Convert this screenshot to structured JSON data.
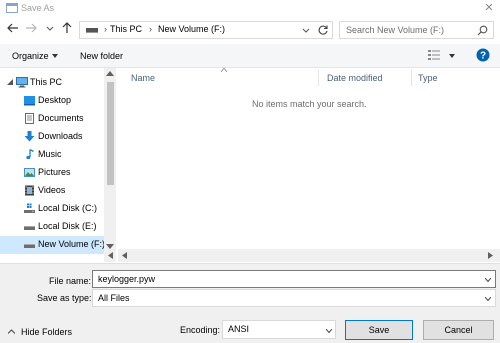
{
  "window": {
    "title": "Save As",
    "close_glyph": "✕"
  },
  "address": {
    "separator": "›",
    "crumbs": [
      "This PC",
      "New Volume (F:)"
    ]
  },
  "search": {
    "placeholder": "Search New Volume (F:)"
  },
  "toolbar": {
    "organize_label": "Organize",
    "new_folder_label": "New folder",
    "help_glyph": "?"
  },
  "sidebar": {
    "items": [
      {
        "label": "This PC",
        "icon": "monitor-icon"
      },
      {
        "label": "Desktop",
        "icon": "desktop-icon"
      },
      {
        "label": "Documents",
        "icon": "documents-icon"
      },
      {
        "label": "Downloads",
        "icon": "download-arrow-icon"
      },
      {
        "label": "Music",
        "icon": "music-note-icon"
      },
      {
        "label": "Pictures",
        "icon": "pictures-icon"
      },
      {
        "label": "Videos",
        "icon": "film-icon"
      },
      {
        "label": "Local Disk (C:)",
        "icon": "windows-drive-icon"
      },
      {
        "label": "Local Disk (E:)",
        "icon": "drive-icon"
      },
      {
        "label": "New Volume (F:)",
        "icon": "drive-icon"
      }
    ],
    "selected_index": 9
  },
  "columns": {
    "name": "Name",
    "date": "Date modified",
    "type": "Type"
  },
  "empty_message": "No items match your search.",
  "form": {
    "file_name_label": "File name:",
    "file_name_value": "keylogger.pyw",
    "save_type_label": "Save as type:",
    "save_type_value": "All Files",
    "encoding_label": "Encoding:",
    "encoding_value": "ANSI"
  },
  "footer": {
    "hide_folders_label": "Hide Folders",
    "save_label": "Save",
    "cancel_label": "Cancel"
  },
  "colors": {
    "accent": "#0078d7",
    "selected": "#cde8ff",
    "panel": "#f0f0f0"
  }
}
